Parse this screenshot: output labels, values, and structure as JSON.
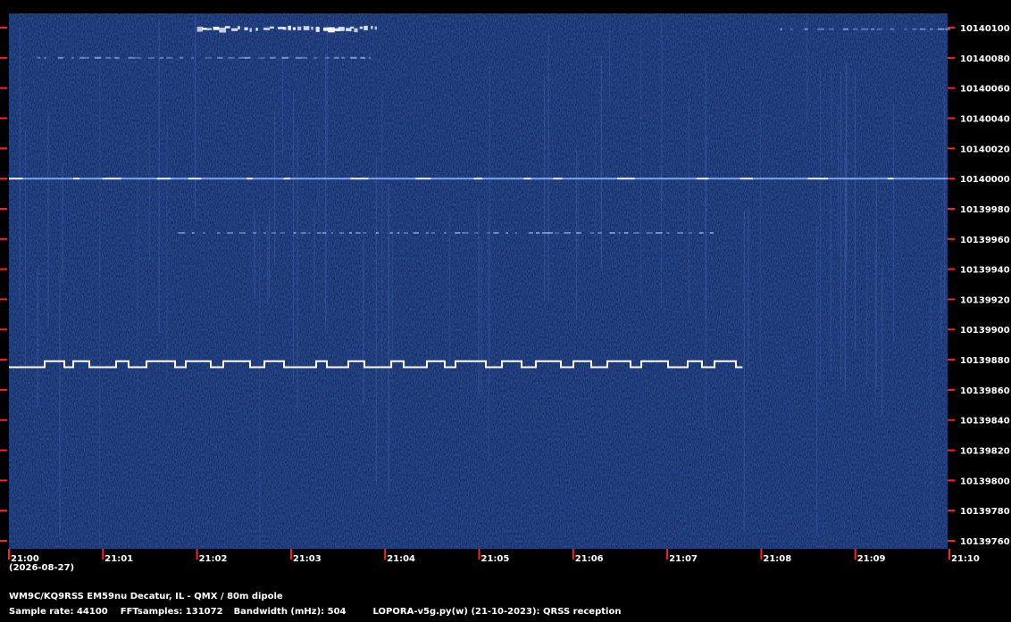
{
  "station_line": "WM9C/KQ9RSS EM59nu Decatur, IL - QMX / 80m dipole",
  "info_line": {
    "sample_rate": "Sample rate: 44100",
    "fft_samples": "FFTsamples: 131072",
    "bandwidth": "Bandwidth (mHz): 504",
    "software": "LOPORA-v5g.py(w) (21-10-2023): QRSS reception"
  },
  "date_label": "(2026-08-27)",
  "colors": {
    "background": "#0b1f55",
    "signal": "#ffffff",
    "tick": "#ff2020",
    "frame": "#000000"
  },
  "chart_data": {
    "type": "heatmap",
    "title": "",
    "xlabel": "",
    "ylabel": "",
    "x_ticks": [
      "21:00",
      "21:01",
      "21:02",
      "21:03",
      "21:04",
      "21:05",
      "21:06",
      "21:07",
      "21:08",
      "21:09",
      "21:10"
    ],
    "y_ticks": [
      10140100,
      10140080,
      10140060,
      10140040,
      10140020,
      10140000,
      10139980,
      10139960,
      10139940,
      10139920,
      10139900,
      10139880,
      10139860,
      10139840,
      10139820,
      10139800,
      10139780,
      10139760
    ],
    "xlim_minutes": [
      0,
      10
    ],
    "ylim_hz": [
      10139752,
      10140108
    ],
    "grid": false,
    "signals": [
      {
        "name": "QRSS FSK carrier",
        "freq_low": 10139875,
        "freq_high": 10139879,
        "start_min": 0,
        "end_min": 7.8,
        "intensity": "strong"
      },
      {
        "name": "steady carrier",
        "freq": 10140000,
        "start_min": 0,
        "end_min": 10,
        "intensity": "medium"
      },
      {
        "name": "burst",
        "freq": 10140099,
        "start_min": 2.0,
        "end_min": 3.9,
        "intensity": "strong"
      },
      {
        "name": "burst",
        "freq": 10140099,
        "start_min": 8.2,
        "end_min": 10,
        "intensity": "weak"
      },
      {
        "name": "faint trace",
        "freq": 10140080,
        "start_min": 0.3,
        "end_min": 3.9,
        "intensity": "weak"
      },
      {
        "name": "faint trace",
        "freq": 10139964,
        "start_min": 1.8,
        "end_min": 7.5,
        "intensity": "weak"
      }
    ]
  }
}
